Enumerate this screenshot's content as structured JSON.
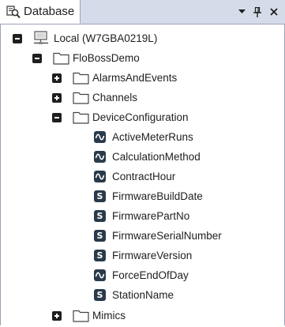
{
  "panel": {
    "title": "Database",
    "title_icon": "database-search-icon",
    "controls": {
      "menu": "dropdown-arrow-icon",
      "pin": "pin-icon",
      "close": "close-icon"
    }
  },
  "tree": {
    "root": {
      "label": "Local (W7GBA0219L)",
      "icon": "network-computer-icon",
      "expanded": true
    },
    "project": {
      "label": "FloBossDemo",
      "icon": "folder-icon",
      "expanded": true
    },
    "groups": {
      "alarms": {
        "label": "AlarmsAndEvents",
        "expanded": false
      },
      "channels": {
        "label": "Channels",
        "expanded": false
      },
      "device": {
        "label": "DeviceConfiguration",
        "expanded": true
      },
      "mimics": {
        "label": "Mimics",
        "expanded": false
      }
    },
    "device_items": [
      {
        "label": "ActiveMeterRuns",
        "type": "wave"
      },
      {
        "label": "CalculationMethod",
        "type": "wave"
      },
      {
        "label": "ContractHour",
        "type": "wave"
      },
      {
        "label": "FirmwareBuildDate",
        "type": "string"
      },
      {
        "label": "FirmwarePartNo",
        "type": "string"
      },
      {
        "label": "FirmwareSerialNumber",
        "type": "string"
      },
      {
        "label": "FirmwareVersion",
        "type": "string"
      },
      {
        "label": "ForceEndOfDay",
        "type": "wave"
      },
      {
        "label": "StationName",
        "type": "string"
      }
    ],
    "string_glyph": "S"
  }
}
